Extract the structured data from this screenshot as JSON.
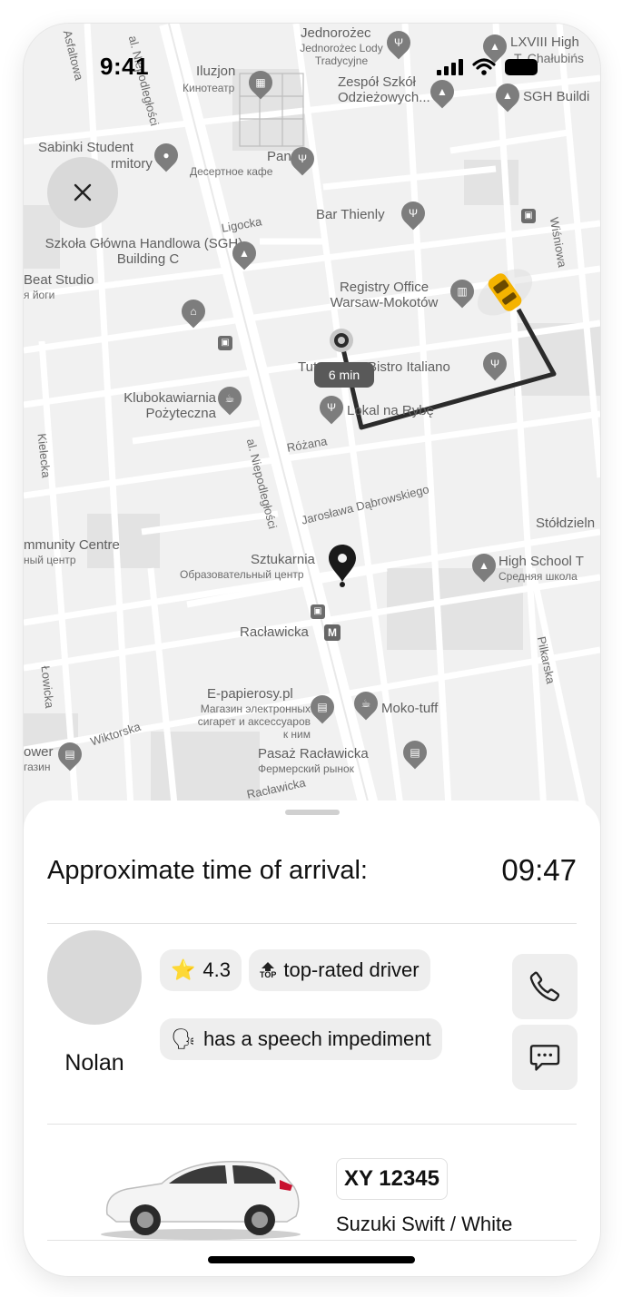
{
  "status_bar": {
    "time": "9:41"
  },
  "map": {
    "route_eta": "6 min",
    "places": [
      {
        "name": "Jednorożec",
        "sub": "Jednorożec Lody Tradycyjne"
      },
      {
        "name": "LXVIII High",
        "sub": "T. Chałubińs"
      },
      {
        "name": "Iluzjon",
        "sub": "Кинотеатр"
      },
      {
        "name": "Zespół Szkół Odzieżowych..."
      },
      {
        "name": "SGH Buildi"
      },
      {
        "name": "Sabinki Student",
        "sub": "rmitory"
      },
      {
        "name": "Panna",
        "sub": "Десертное кафе"
      },
      {
        "name": "Bar Thienly"
      },
      {
        "name": "Szkoła Główna Handlowa (SGH) - Building C"
      },
      {
        "name": "Beat Studio",
        "sub": "я йоги"
      },
      {
        "name": "Registry Office Warsaw-Mokotów"
      },
      {
        "name": "Tutto Bene Bistro Italiano"
      },
      {
        "name": "Klubokawiarnia Pożyteczna"
      },
      {
        "name": "Lokal na Rybę"
      },
      {
        "name": "mmunity Centre",
        "sub": "ный центр"
      },
      {
        "name": "Sztukarnia",
        "sub": "Образовательный центр"
      },
      {
        "name": "High School T",
        "sub": "Средняя школа"
      },
      {
        "name": "Stółdzieln"
      },
      {
        "name": "Racławicka"
      },
      {
        "name": "E-papierosy.pl",
        "sub": "Магазин электронных сигарет и аксессуаров к ним"
      },
      {
        "name": "Moko-tuff"
      },
      {
        "name": "ower",
        "sub": "газин"
      },
      {
        "name": "Pasaż Racławicka",
        "sub": "Фермерский рынок"
      }
    ],
    "streets": {
      "niepodleglosci_top": "al. Niepodległości",
      "niepodleglosci_mid": "al. Niepodległości",
      "asfaltowa": "Asfaltowa",
      "ligocka": "Ligocka",
      "rozana": "Różana",
      "dabrowskiego": "Jarosława Dąbrowskiego",
      "kielecka": "Kielecka",
      "lowicka": "Łowicka",
      "wiktorska": "Wiktorska",
      "raclawicka_bottom": "Racławicka",
      "wisniowa": "Wiśniowa",
      "pilkarska": "Pilkarska"
    }
  },
  "trip": {
    "eta_label": "Approximate time of arrival:",
    "eta_time": "09:47",
    "driver": {
      "name": "Nolan",
      "rating": "4.3",
      "badge_top": "top-rated driver",
      "top_icon_text": "TOP",
      "badge_speech": "has a speech impediment"
    },
    "car": {
      "plate": "XY 12345",
      "model": "Suzuki Swift / White"
    }
  },
  "icons": [
    "close-icon",
    "star-icon",
    "top-rated-icon",
    "speaking-head-icon",
    "phone-icon",
    "chat-icon",
    "car-image",
    "signal-icon",
    "wifi-icon",
    "battery-icon"
  ],
  "colors": {
    "route": "#2b2b2b",
    "taxi": "#f5b300",
    "chip_bg": "#eeeeee",
    "avatar_bg": "#d9d9d9"
  }
}
